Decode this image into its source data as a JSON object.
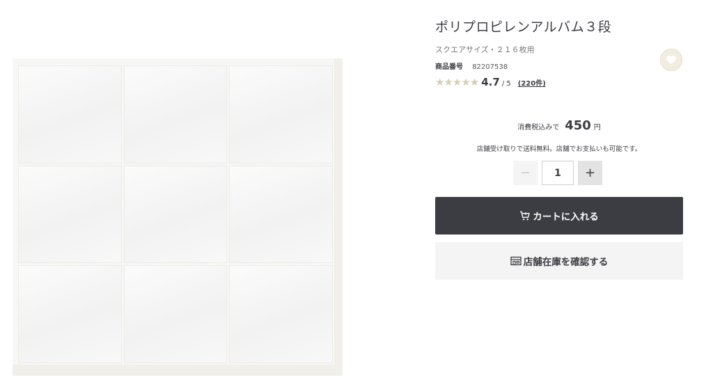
{
  "product": {
    "title": "ポリプロピレンアルバム３段",
    "subtitle": "スクエアサイズ・２１６枚用",
    "sku_label": "商品番号",
    "sku": "82207538",
    "rating": {
      "stars": "★★★★★",
      "value": "4.7",
      "max": "/ 5",
      "reviews": "(220件)"
    }
  },
  "price": {
    "prefix": "消費税込みで",
    "value": "450",
    "unit": "円"
  },
  "pickup_note": "店舗受け取りで送料無料。店舗でお支払いも可能です。",
  "quantity": {
    "minus": "−",
    "value": "1",
    "plus": "+"
  },
  "buttons": {
    "cart": "カートに入れる",
    "stock": "店舗在庫を確認する"
  },
  "icons": {
    "favorite": "heart-icon",
    "cart": "cart-icon",
    "stock": "store-icon"
  },
  "colors": {
    "primary_dark": "#3c3c43",
    "secondary_bg": "#f4f4f4",
    "star": "#d8cdb2",
    "favorite_bg": "#f3ece1"
  }
}
